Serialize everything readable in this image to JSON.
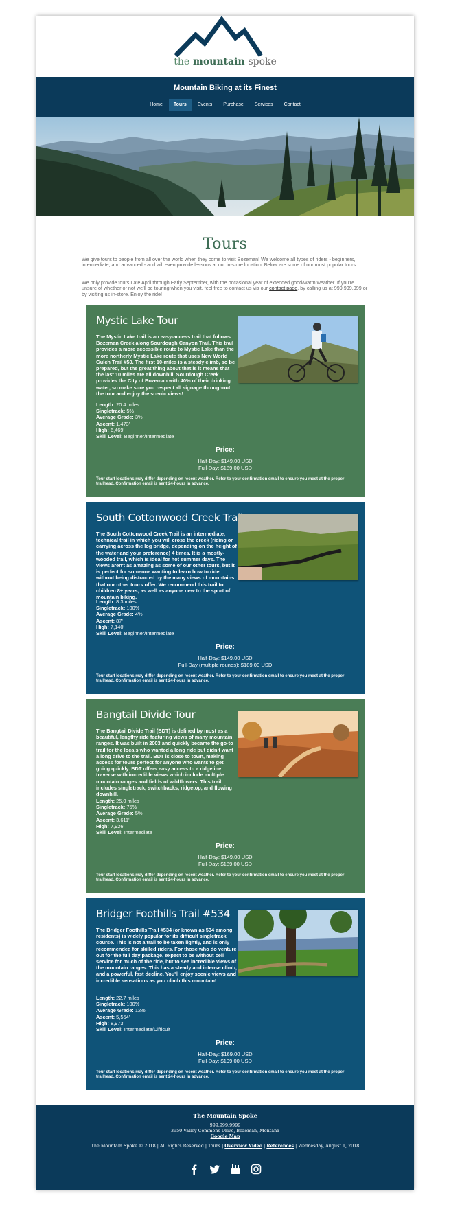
{
  "brand": {
    "logo_the": "the",
    "logo_mountain": "mountain",
    "logo_spoke": "spoke"
  },
  "header": {
    "tagline": "Mountain Biking at its Finest",
    "nav": [
      "Home",
      "Tours",
      "Events",
      "Purchase",
      "Services",
      "Contact"
    ],
    "active_nav": "Tours"
  },
  "page_title": "Tours",
  "intro": {
    "p1": "We give tours to people from all over the world when they come to visit Bozeman! We welcome all types of riders - beginners, intermediate, and advanced - and will even provide lessons at our in-store location. Below are some of our most popular tours.",
    "p2_before": "We only provide tours Late April through Early September, with the occasional year of extended good/warm weather. If you're unsure of whether or not we'll be touring when you visit, feel free to contact us via our ",
    "p2_link": "contact page",
    "p2_after": ", by calling us at 999.999.999 or by visiting us in-store. Enjoy the ride!"
  },
  "stat_labels": {
    "length": "Length:",
    "singletrack": "Singletrack:",
    "grade": "Average Grade:",
    "ascent": "Ascent:",
    "high": "High:",
    "skill": "Skill Level:"
  },
  "price_heading": "Price:",
  "tour_note": "Tour start locations may differ depending on recent weather. Refer to your confirmation email to ensure you meet at the proper trailhead. Confirmation email is sent 24-hours in advance.",
  "tours": [
    {
      "name": "Mystic Lake Tour",
      "description": "The Mystic Lake trail is an easy-access trail that follows Bozeman Creek along Sourdough Canyon Trail. This trail provides a more accessible route to Mystic Lake than the more northerly Mystic Lake route that uses New World Gulch Trail #50. The first 10-miles is a steady climb, so be prepared, but the great thing about that is it means that the last 10 miles are all downhill. Sourdough Creek provides the City of Bozeman with 40% of their drinking water, so make sure you respect all signage throughout the tour and enjoy the scenic views!",
      "length": "20.4 miles",
      "singletrack": "5%",
      "grade": "3%",
      "ascent": "1,473'",
      "high": "6,469'",
      "skill": "Beginner/Intermediate",
      "price_1": "Half-Day: $149.00 USD",
      "price_2": "Full-Day: $189.00 USD"
    },
    {
      "name": "South Cottonwood Creek Trail",
      "description": "The South Cottonwood Creek Trail is an intermediate, technical trail in which you will cross the creek (riding or carrying across the log bridge, depending on the height of the water and your preference) 4 times. It is a mostly-wooded trail, which is ideal for hot summer days. The views aren't as amazing as some of our other tours, but it is perfect for someone wanting to learn how to ride without being distracted by the many views of mountains that our other tours offer. We recommend this trail to children 8+ years, as well as anyone new to the sport of mountain biking.",
      "length": "8.3 miles",
      "singletrack": "100%",
      "grade": "4%",
      "ascent": "87'",
      "high": "7,140'",
      "skill": "Beginner/Intermediate",
      "price_1": "Half-Day: $149.00 USD",
      "price_2": "Full-Day (multiple rounds): $189.00 USD"
    },
    {
      "name": "Bangtail Divide Tour",
      "description": "The Bangtail Divide Trail (BDT) is defined by most as a beautiful, lengthy ride featuring views of many mountain ranges. It was built in 2003 and quickly became the go-to trail for the locals who wanted a long ride but didn't want a long drive to the trail. BDT is close to town, making access for tours perfect for anyone who wants to get going quickly. BDT offers easy access to a ridgeline traverse with incredible views which include multiple mountain ranges and fields of wildflowers. This trail includes singletrack, switchbacks, ridgetop, and flowing downhill.",
      "length": "25.0 miles",
      "singletrack": "75%",
      "grade": "5%",
      "ascent": "3,611'",
      "high": "7,926'",
      "skill": "Intermediate",
      "price_1": "Half-Day: $149.00 USD",
      "price_2": "Full-Day: $189.00 USD"
    },
    {
      "name": "Bridger Foothills Trail #534",
      "description": "The Bridger Foothills Trail #534 (or known as 534 among residents) is widely popular for its difficult singletrack course. This is not a trail to be taken lightly, and is only recommended for skilled riders. For those who do venture out for the full day package, expect to be without cell service for much of the ride, but to see incredible views of the mountain ranges. This has a steady and intense climb, and a powerful, fast decline. You'll enjoy scenic views and incredible sensations as you climb this mountain!",
      "length": "22.7 miles",
      "singletrack": "100%",
      "grade": "12%",
      "ascent": "5,554'",
      "high": "8,973'",
      "skill": "Intermediate/Difficult",
      "price_1": "Half-Day: $169.00 USD",
      "price_2": "Full-Day: $199.00 USD"
    }
  ],
  "footer": {
    "title": "The Mountain Spoke",
    "phone": "999.999.9999",
    "address": "3950 Valley Commons Drive, Bozeman, Montana",
    "map_link": "Google Map",
    "copyright": "The Mountain Spoke © 2018 | All Rights Reserved | Tours |",
    "video_link": "Overview Video",
    "sep": "|",
    "references_link": "References",
    "date": "| Wednesday, August 1, 2018"
  },
  "colors": {
    "navy": "#0b3a5a",
    "green": "#4a7d56",
    "blue": "#0f5378"
  },
  "icons": [
    "facebook-icon",
    "twitter-icon",
    "youtube-icon",
    "instagram-icon"
  ]
}
